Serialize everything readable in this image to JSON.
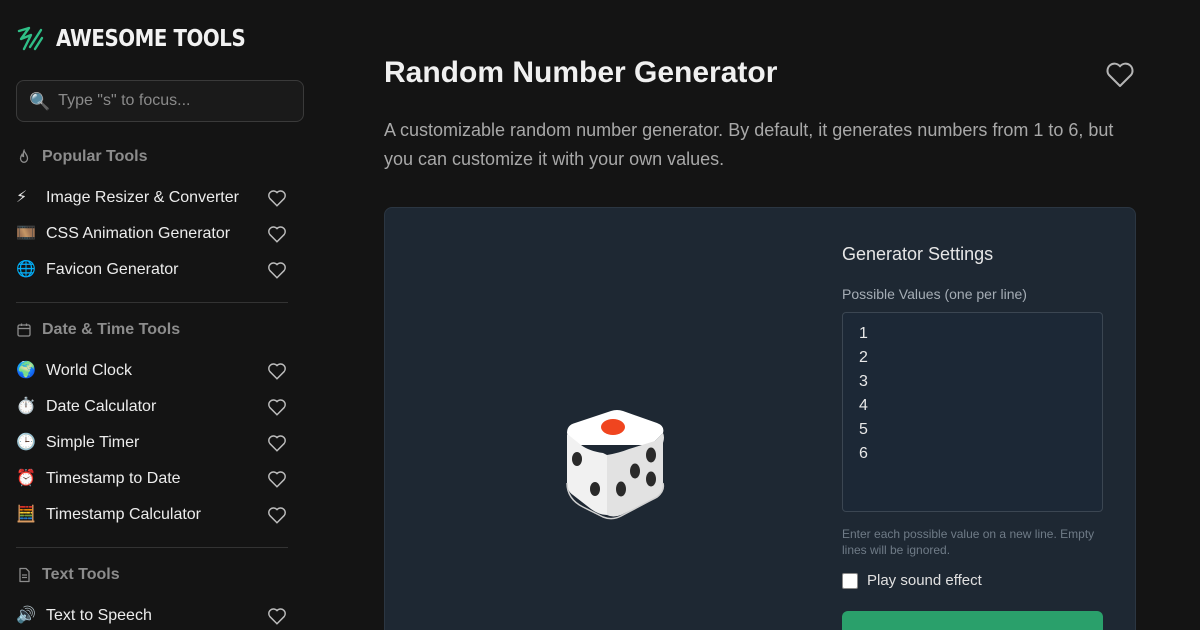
{
  "brand": {
    "name": "AWESOME TOOLS",
    "accent": "#2fbf87"
  },
  "search": {
    "placeholder": "Type \"s\" to focus..."
  },
  "sidebar": {
    "sections": [
      {
        "title": "Popular Tools",
        "icon": "flame-icon",
        "items": [
          {
            "emoji": "⚡",
            "label": "Image Resizer & Converter"
          },
          {
            "emoji": "🎞️",
            "label": "CSS Animation Generator"
          },
          {
            "emoji": "🌐",
            "label": "Favicon Generator"
          }
        ]
      },
      {
        "title": "Date & Time Tools",
        "icon": "calendar-icon",
        "items": [
          {
            "emoji": "🌍",
            "label": "World Clock"
          },
          {
            "emoji": "⏱️",
            "label": "Date Calculator"
          },
          {
            "emoji": "🕒",
            "label": "Simple Timer"
          },
          {
            "emoji": "⏰",
            "label": "Timestamp to Date"
          },
          {
            "emoji": "🧮",
            "label": "Timestamp Calculator"
          }
        ]
      },
      {
        "title": "Text Tools",
        "icon": "document-icon",
        "items": [
          {
            "emoji": "🔊",
            "label": "Text to Speech"
          }
        ]
      }
    ]
  },
  "main": {
    "title": "Random Number Generator",
    "description": "A customizable random number generator. By default, it generates numbers from 1 to 6, but you can customize it with your own values.",
    "settings": {
      "title": "Generator Settings",
      "values_label": "Possible Values (one per line)",
      "values": [
        "1",
        "2",
        "3",
        "4",
        "5",
        "6"
      ],
      "hint": "Enter each possible value on a new line. Empty lines will be ignored.",
      "sound_label": "Play sound effect",
      "sound_checked": false,
      "button_color": "#2aa06b"
    }
  }
}
